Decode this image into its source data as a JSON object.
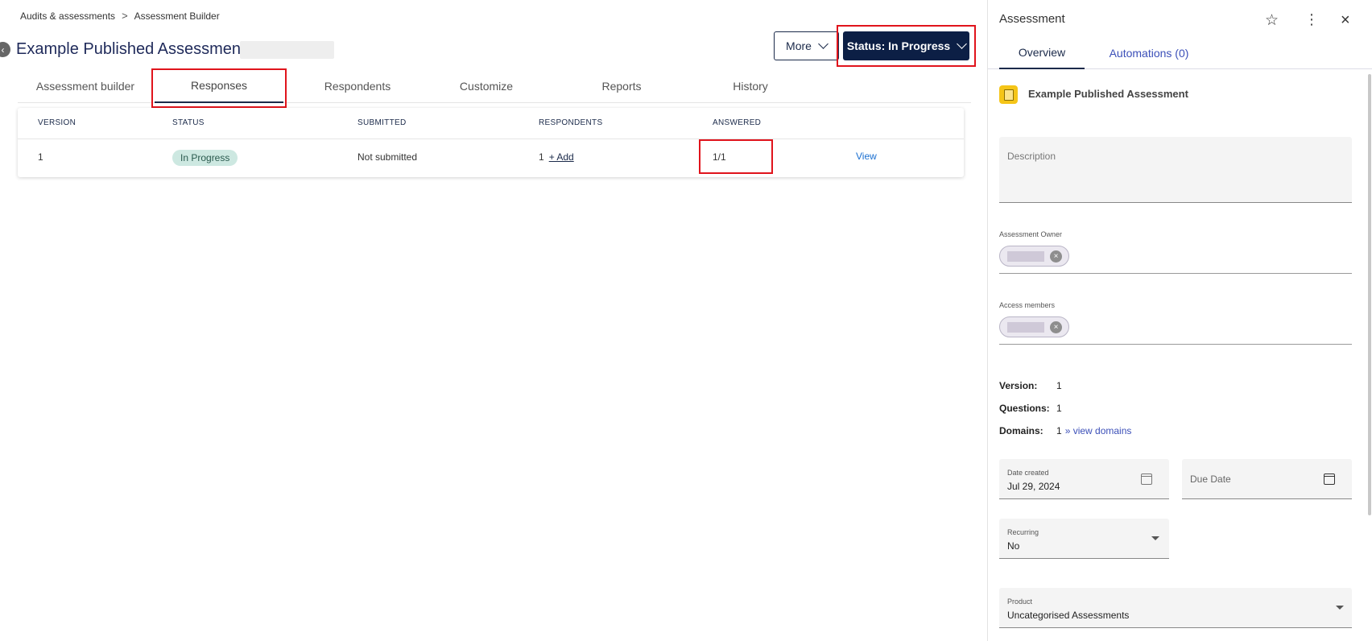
{
  "breadcrumb": {
    "items": [
      "Audits & assessments",
      "Assessment Builder"
    ],
    "separator": ">"
  },
  "header": {
    "title": "Example Published Assessment",
    "more_label": "More",
    "status_label": "Status: In Progress"
  },
  "tabs": [
    "Assessment builder",
    "Responses",
    "Respondents",
    "Customize",
    "Reports",
    "History"
  ],
  "table": {
    "columns": [
      "VERSION",
      "STATUS",
      "SUBMITTED",
      "RESPONDENTS",
      "ANSWERED"
    ],
    "rows": [
      {
        "version": "1",
        "status": "In Progress",
        "submitted": "Not submitted",
        "respondents_count": "1",
        "add_label": "+ Add",
        "answered": "1/1",
        "view_label": "View"
      }
    ]
  },
  "panel": {
    "title": "Assessment",
    "tabs": [
      "Overview",
      "Automations (0)"
    ],
    "assessment_name": "Example Published Assessment",
    "description_label": "Description",
    "owner_label": "Assessment Owner",
    "access_label": "Access members",
    "version_label": "Version:",
    "version_value": "1",
    "questions_label": "Questions:",
    "questions_value": "1",
    "domains_label": "Domains:",
    "domains_value": "1",
    "domains_link": "» view domains",
    "date_created_label": "Date created",
    "date_created_value": "Jul 29, 2024",
    "due_date_label": "Due Date",
    "recurring_label": "Recurring",
    "recurring_value": "No",
    "product_label": "Product",
    "product_value": "Uncategorised Assessments"
  },
  "colors": {
    "primary": "#0c1f45",
    "highlight": "#e0141c",
    "badge": "#cde8e1",
    "link": "#3b4fb8",
    "icon_accent": "#f5c518"
  }
}
